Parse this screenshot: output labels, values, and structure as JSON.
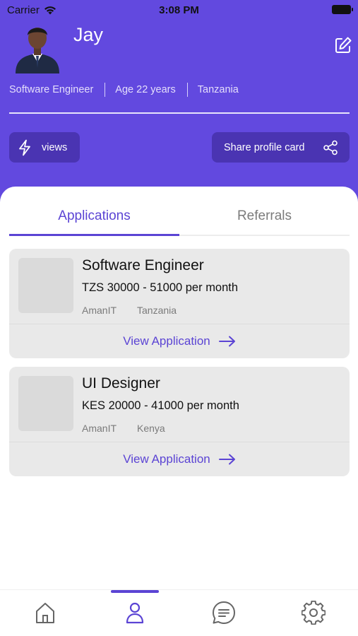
{
  "status_bar": {
    "carrier": "Carrier",
    "time": "3:08 PM"
  },
  "profile": {
    "name": "Jay",
    "occupation": "Software Engineer",
    "age": "Age 22 years",
    "country": "Tanzania"
  },
  "actions": {
    "views_label": "views",
    "share_label": "Share profile card"
  },
  "tabs": [
    {
      "label": "Applications",
      "active": true
    },
    {
      "label": "Referrals",
      "active": false
    }
  ],
  "applications": [
    {
      "title": "Software Engineer",
      "salary": "TZS 30000 - 51000 per month",
      "company": "AmanIT",
      "location": "Tanzania",
      "link_label": "View Application"
    },
    {
      "title": "UI Designer",
      "salary": "KES 20000 - 41000 per month",
      "company": "AmanIT",
      "location": "Kenya",
      "link_label": "View Application"
    }
  ],
  "bottom_nav": {
    "items": [
      {
        "icon": "home-icon",
        "active": false
      },
      {
        "icon": "profile-icon",
        "active": true
      },
      {
        "icon": "chat-icon",
        "active": false
      },
      {
        "icon": "settings-icon",
        "active": false
      }
    ]
  },
  "colors": {
    "brand": "#6249df",
    "button_dark": "#4a34b2",
    "accent": "#5b44d4"
  }
}
